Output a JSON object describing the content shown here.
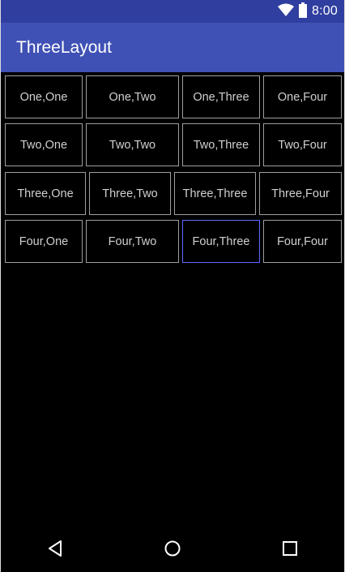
{
  "status_bar": {
    "time": "8:00",
    "icons": [
      "wifi-icon",
      "battery-icon"
    ]
  },
  "app_bar": {
    "title": "ThreeLayout"
  },
  "grid": {
    "rows": [
      [
        "One,One",
        "One,Two",
        "One,Three",
        "One,Four"
      ],
      [
        "Two,One",
        "Two,Two",
        "Two,Three",
        "Two,Four"
      ],
      [
        "Three,One",
        "Three,Two",
        "Three,Three",
        "Three,Four"
      ],
      [
        "Four,One",
        "Four,Two",
        "Four,Three",
        "Four,Four"
      ]
    ],
    "focused": "Four,Three"
  },
  "nav_bar": {
    "buttons": [
      "back-icon",
      "home-icon",
      "recents-icon"
    ]
  },
  "colors": {
    "status_bar": "#303f9f",
    "app_bar": "#3f51b5",
    "cell_border": "#9e9e9e",
    "focus_border": "#5c6bff",
    "cell_text": "#d0d0d0",
    "background": "#000000"
  }
}
